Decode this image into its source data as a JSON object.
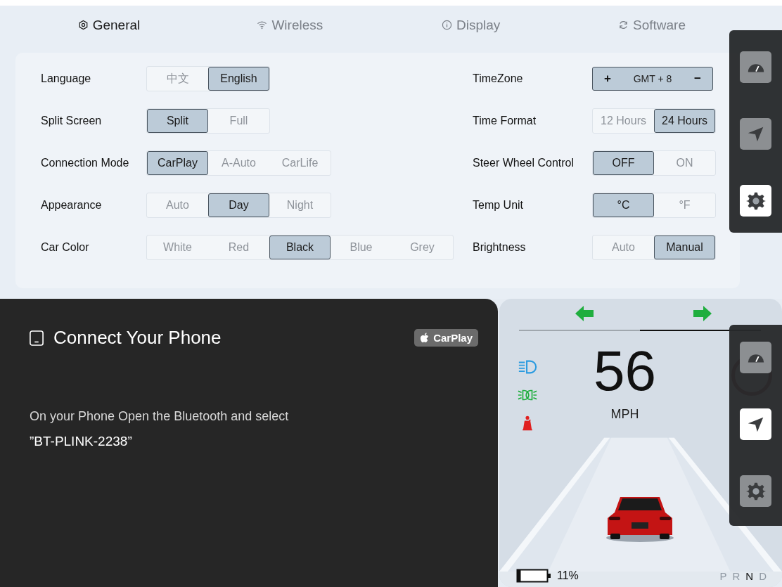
{
  "tabs": [
    {
      "label": "General",
      "kind": "general",
      "selected": true
    },
    {
      "label": "Wireless",
      "kind": "wireless",
      "selected": false
    },
    {
      "label": "Display",
      "kind": "display",
      "selected": false
    },
    {
      "label": "Software",
      "kind": "software",
      "selected": false
    }
  ],
  "settings": {
    "left": [
      {
        "kind": "segmented",
        "label": "Language",
        "options": [
          {
            "label": "中文",
            "selected": false
          },
          {
            "label": "English",
            "selected": true
          }
        ]
      },
      {
        "kind": "segmented",
        "label": "Split Screen",
        "options": [
          {
            "label": "Split",
            "selected": true
          },
          {
            "label": "Full",
            "selected": false
          }
        ]
      },
      {
        "kind": "segmented",
        "label": "Connection Mode",
        "options": [
          {
            "label": "CarPlay",
            "selected": true
          },
          {
            "label": "A-Auto",
            "selected": false
          },
          {
            "label": "CarLife",
            "selected": false
          }
        ]
      },
      {
        "kind": "segmented",
        "label": "Appearance",
        "options": [
          {
            "label": "Auto",
            "selected": false
          },
          {
            "label": "Day",
            "selected": true
          },
          {
            "label": "Night",
            "selected": false
          }
        ]
      },
      {
        "kind": "segmented",
        "label": "Car Color",
        "options": [
          {
            "label": "White",
            "selected": false
          },
          {
            "label": "Red",
            "selected": false
          },
          {
            "label": "Black",
            "selected": true
          },
          {
            "label": "Blue",
            "selected": false
          },
          {
            "label": "Grey",
            "selected": false
          }
        ]
      }
    ],
    "right": [
      {
        "kind": "stepper",
        "label": "TimeZone",
        "increase": "+",
        "value": "GMT + 8",
        "decrease": "−"
      },
      {
        "kind": "segmented",
        "label": "Time Format",
        "options": [
          {
            "label": "12 Hours",
            "selected": false
          },
          {
            "label": "24 Hours",
            "selected": true
          }
        ]
      },
      {
        "kind": "segmented",
        "label": "Steer Wheel Control",
        "options": [
          {
            "label": "OFF",
            "selected": true
          },
          {
            "label": "ON",
            "selected": false
          }
        ]
      },
      {
        "kind": "segmented",
        "label": "Temp Unit",
        "options": [
          {
            "label": "°C",
            "selected": true
          },
          {
            "label": "°F",
            "selected": false
          }
        ]
      },
      {
        "kind": "segmented",
        "label": "Brightness",
        "options": [
          {
            "label": "Auto",
            "selected": false
          },
          {
            "label": "Manual",
            "selected": true
          }
        ]
      }
    ]
  },
  "docks": [
    {
      "items": [
        {
          "selected": false
        },
        {
          "selected": false
        },
        {
          "selected": true
        }
      ]
    },
    {
      "items": [
        {
          "selected": false
        },
        {
          "selected": true
        },
        {
          "selected": false
        }
      ]
    }
  ],
  "phone_card": {
    "title": "Connect Your Phone",
    "badge": "CarPlay",
    "instruction": "On your Phone Open the Bluetooth and select",
    "device_name": "”BT-PLINK-2238”"
  },
  "cluster": {
    "speed": "56",
    "unit": "MPH",
    "battery": "11%",
    "gears": [
      {
        "label": "P",
        "selected": false
      },
      {
        "label": "R",
        "selected": false
      },
      {
        "label": "N",
        "selected": true
      },
      {
        "label": "D",
        "selected": false
      }
    ]
  }
}
